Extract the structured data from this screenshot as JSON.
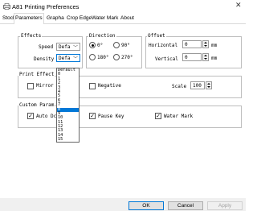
{
  "window": {
    "title": "A81 Printing Preferences",
    "close": "✕"
  },
  "tabs": [
    {
      "label": "Stock",
      "active": false
    },
    {
      "label": "Parameters",
      "active": true
    },
    {
      "label": "Grapha",
      "active": false
    },
    {
      "label": "Crop Edge",
      "active": false
    },
    {
      "label": "Water Mark",
      "active": false
    },
    {
      "label": "About",
      "active": false
    }
  ],
  "effects": {
    "group_label": "Effects",
    "speed_label": "Speed",
    "speed_value": "Defa",
    "density_label": "Density",
    "density_value": "Defa"
  },
  "direction": {
    "group_label": "Direction",
    "options": [
      "0°",
      "90°",
      "180°",
      "270°"
    ],
    "selected": "0°"
  },
  "offset": {
    "group_label": "Offset",
    "horizontal_label": "Horizontal",
    "horizontal_value": "0",
    "vertical_label": "Vertical",
    "vertical_value": "0",
    "unit": "mm"
  },
  "print_effect": {
    "group_label": "Print Effect",
    "mirror_label": "Mirror",
    "mirror_checked": false,
    "negative_label": "Negative",
    "negative_checked": false,
    "scale_label": "Scale",
    "scale_value": "100"
  },
  "custom": {
    "group_label": "Custom Param",
    "auto_label": "Auto Dc",
    "auto_checked": true,
    "pause_label": "Pause Key",
    "pause_checked": true,
    "watermark_label": "Water Mark",
    "watermark_checked": true
  },
  "density_dropdown": {
    "items": [
      "Default",
      "0",
      "1",
      "2",
      "3",
      "4",
      "5",
      "6",
      "7",
      "8",
      "9",
      "10",
      "11",
      "12",
      "13",
      "14",
      "15"
    ],
    "highlighted": "8"
  },
  "footer": {
    "ok": "OK",
    "cancel": "Cancel",
    "apply": "Apply"
  },
  "check_mark": "✓"
}
